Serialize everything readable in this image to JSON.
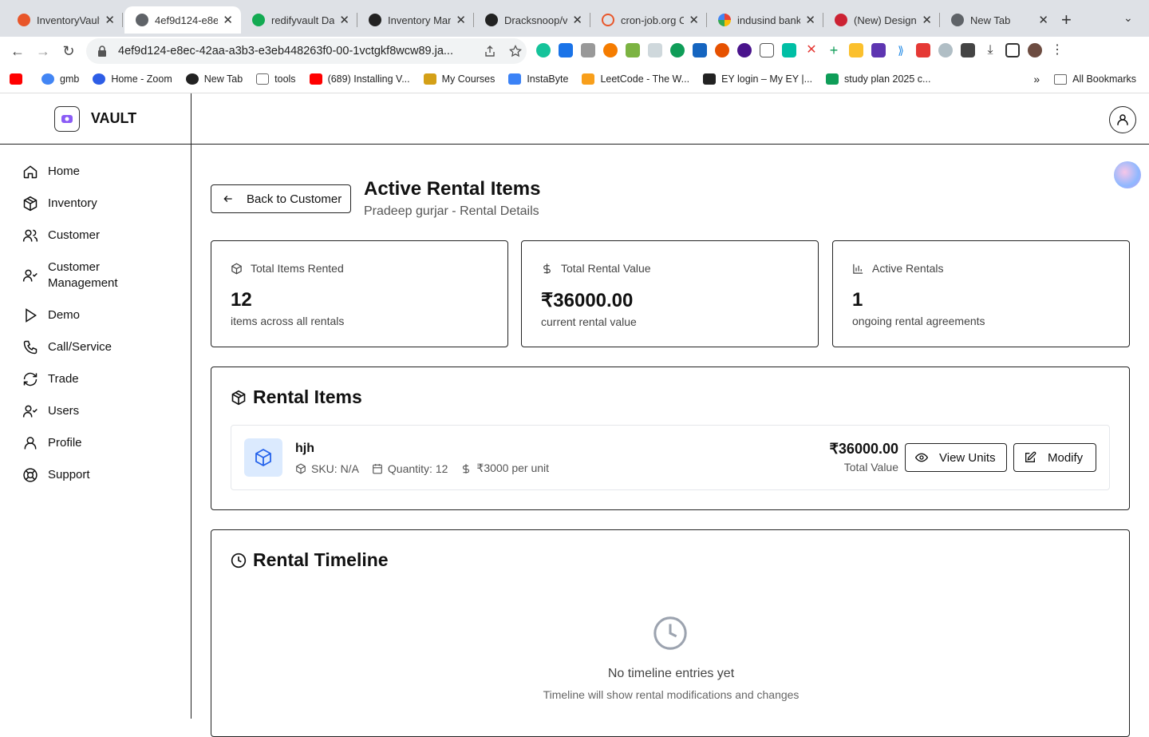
{
  "browser": {
    "tabs": [
      {
        "title": "InventoryVault",
        "color": "#e8562a"
      },
      {
        "title": "4ef9d124-e8e",
        "color": "#5f6368"
      },
      {
        "title": "redifyvault Dat",
        "color": "#13aa52"
      },
      {
        "title": "Inventory Man",
        "color": "#222222"
      },
      {
        "title": "Dracksnoop/va",
        "color": "#222222"
      },
      {
        "title": "cron-job.org C",
        "color": "#e8562a"
      },
      {
        "title": "indusind bank",
        "color": "#4285f4"
      },
      {
        "title": "(New) Designe",
        "color": "#c23"
      },
      {
        "title": "New Tab",
        "color": "#5f6368"
      }
    ],
    "url": "4ef9d124-e8ec-42aa-a3b3-e3eb448263f0-00-1vctgkf8wcw89.ja...",
    "bookmarks": [
      {
        "label": "",
        "color": "#ff0000"
      },
      {
        "label": "gmb",
        "color": "#4285f4"
      },
      {
        "label": "Home - Zoom",
        "color": "#2d5de6"
      },
      {
        "label": "New Tab",
        "color": "#222222"
      },
      {
        "label": "tools",
        "color": "#666666"
      },
      {
        "label": "(689) Installing V...",
        "color": "#ff0000"
      },
      {
        "label": "My Courses",
        "color": "#d4a017"
      },
      {
        "label": "InstaByte",
        "color": "#3b82f6"
      },
      {
        "label": "LeetCode - The W...",
        "color": "#f89f1b"
      },
      {
        "label": "EY login – My EY |...",
        "color": "#222222"
      },
      {
        "label": "study plan 2025 c...",
        "color": "#0f9d58"
      }
    ],
    "all_bookmarks": "All Bookmarks"
  },
  "brand": {
    "name": "VAULT"
  },
  "sidebar": {
    "items": [
      {
        "label": "Home",
        "icon": "home-icon"
      },
      {
        "label": "Inventory",
        "icon": "box-icon"
      },
      {
        "label": "Customer",
        "icon": "users-icon"
      },
      {
        "label": "Customer Management",
        "icon": "user-check-icon"
      },
      {
        "label": "Demo",
        "icon": "play-icon"
      },
      {
        "label": "Call/Service",
        "icon": "phone-icon"
      },
      {
        "label": "Trade",
        "icon": "refresh-icon"
      },
      {
        "label": "Users",
        "icon": "user-check-icon"
      },
      {
        "label": "Profile",
        "icon": "user-icon"
      },
      {
        "label": "Support",
        "icon": "lifebuoy-icon"
      }
    ]
  },
  "header": {
    "back_label": "Back to Customer",
    "title": "Active Rental Items",
    "subtitle": "Pradeep gurjar - Rental Details"
  },
  "stats": [
    {
      "label": "Total Items Rented",
      "value": "12",
      "desc": "items across all rentals"
    },
    {
      "label": "Total Rental Value",
      "value": "₹36000.00",
      "desc": "current rental value"
    },
    {
      "label": "Active Rentals",
      "value": "1",
      "desc": "ongoing rental agreements"
    }
  ],
  "rental_items": {
    "title": "Rental Items",
    "items": [
      {
        "name": "hjh",
        "sku": "SKU: N/A",
        "quantity": "Quantity: 12",
        "rate": "₹3000 per unit",
        "total": "₹36000.00",
        "total_label": "Total Value"
      }
    ],
    "view_units_label": "View Units",
    "modify_label": "Modify"
  },
  "timeline": {
    "title": "Rental Timeline",
    "empty_title": "No timeline entries yet",
    "empty_sub": "Timeline will show rental modifications and changes"
  }
}
